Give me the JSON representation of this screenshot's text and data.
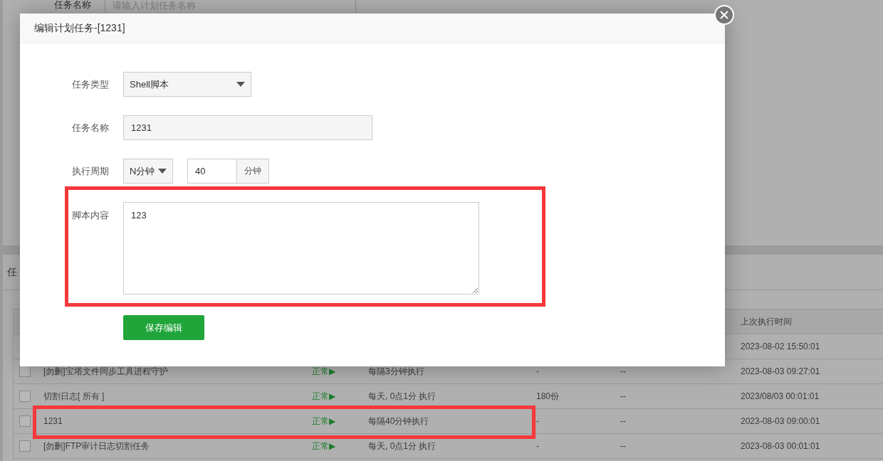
{
  "search_form": {
    "label": "任务名称",
    "placeholder": "请输入计划任务名称"
  },
  "task_panel": {
    "title": "任"
  },
  "table": {
    "columns": {
      "last_run": "上次执行时间"
    },
    "rows": [
      {
        "last_run": "2023-08-02 15:50:01"
      },
      {
        "checked": false,
        "name": "[勿删]宝塔文件同步工具进程守护",
        "status": "正常▶",
        "cycle": "每隔3分钟执行",
        "backup": "-",
        "column_6": "--",
        "last_run": "2023-08-03 09:27:01"
      },
      {
        "checked": false,
        "name": "切割日志[ 所有 ]",
        "status": "正常▶",
        "cycle": "每天, 0点1分 执行",
        "backup": "180份",
        "column_6": "--",
        "last_run": "2023/08/03 00:01:01"
      },
      {
        "checked": false,
        "name": "1231",
        "status": "正常▶",
        "cycle": "每隔40分钟执行",
        "backup": "-",
        "column_6": "--",
        "last_run": "2023-08-03 09:00:01"
      },
      {
        "checked": false,
        "name": "[勿删]FTP审计日志切割任务",
        "status": "正常▶",
        "cycle": "每天, 0点1分 执行",
        "backup": "-",
        "column_6": "--",
        "last_run": "2023-08-03 00:01:01"
      }
    ]
  },
  "dialog": {
    "title": "编辑计划任务-[1231]",
    "task_type": {
      "label": "任务类型",
      "value": "Shell脚本"
    },
    "task_name": {
      "label": "任务名称",
      "value": "1231"
    },
    "cycle": {
      "label": "执行周期",
      "type_value": "N分钟",
      "minutes_value": "40",
      "unit": "分钟"
    },
    "script": {
      "label": "脚本内容",
      "value": "123"
    },
    "save_button": "保存编辑"
  }
}
